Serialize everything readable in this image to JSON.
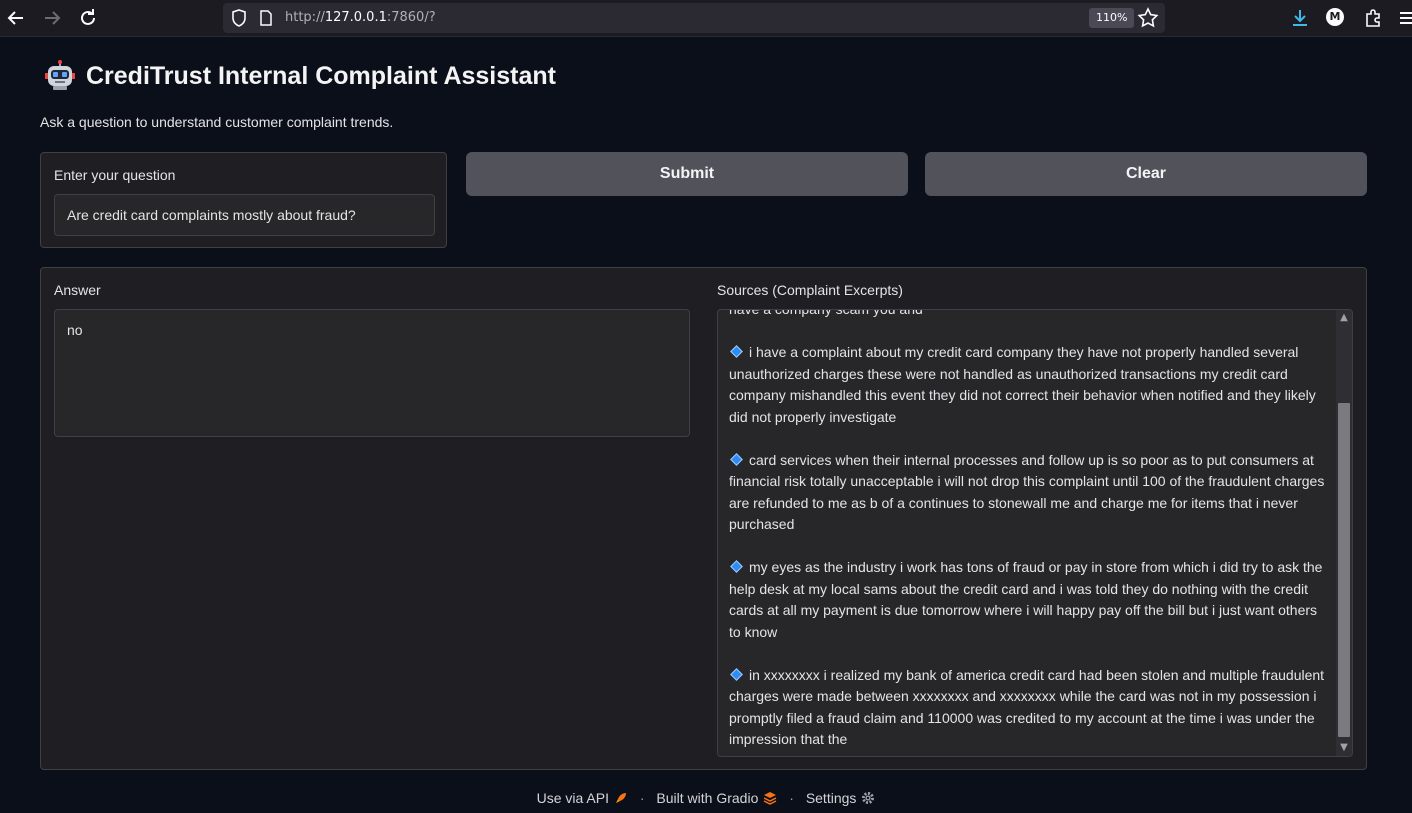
{
  "browser": {
    "url_prefix": "http://",
    "url_host": "127.0.0.1",
    "url_rest": ":7860/?",
    "zoom": "110%",
    "profile_initial": "M"
  },
  "app": {
    "title": "CrediTrust Internal Complaint Assistant",
    "subtitle": "Ask a question to understand customer complaint trends."
  },
  "question": {
    "label": "Enter your question",
    "value": "Are credit card complaints mostly about fraud?"
  },
  "buttons": {
    "submit": "Submit",
    "clear": "Clear"
  },
  "answer": {
    "label": "Answer",
    "text": "no"
  },
  "sources": {
    "label": "Sources (Complaint Excerpts)",
    "partial_top": "have a company scam you and",
    "excerpts": [
      "i have a complaint about my credit card company they have not properly handled several unauthorized charges these were not handled as unauthorized transactions my credit card company mishandled this event they did not correct their behavior when notified and they likely did not properly investigate",
      "card services when their internal processes and follow up is so poor as to put consumers at financial risk totally unacceptable i will not drop this complaint until 100 of the fraudulent charges are refunded to me as b of a continues to stonewall me and charge me for items that i never purchased",
      "my eyes as the industry i work has tons of fraud or pay in store from which i did try to ask the help desk at my local sams about the credit card and i was told they do nothing with the credit cards at all my payment is due tomorrow where i will happy pay off the bill but i just want others to know",
      "in xxxxxxxx i realized my bank of america credit card had been stolen and multiple fraudulent charges were made between xxxxxxxx and xxxxxxxx while the card was not in my possession i promptly filed a fraud claim and 110000 was credited to my account at the time i was under the impression that the"
    ],
    "bullet_icon": "blue-diamond-icon"
  },
  "footer": {
    "api": "Use via API",
    "built": "Built with Gradio",
    "settings": "Settings",
    "separator": "·"
  }
}
